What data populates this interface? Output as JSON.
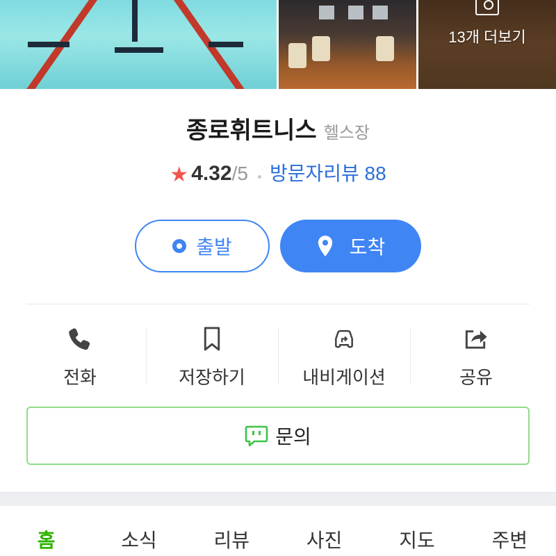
{
  "photos": {
    "more_label": "13개 더보기",
    "items": [
      "pool-photo",
      "lounge-photo",
      "gym-photo"
    ]
  },
  "place": {
    "name": "종로휘트니스",
    "category": "헬스장"
  },
  "rating": {
    "star": "★",
    "value": "4.32",
    "max": "/5",
    "review_link": "방문자리뷰 88"
  },
  "route": {
    "depart_label": "출발",
    "arrive_label": "도착"
  },
  "actions": [
    {
      "label": "전화",
      "icon": "phone-icon"
    },
    {
      "label": "저장하기",
      "icon": "bookmark-icon"
    },
    {
      "label": "내비게이션",
      "icon": "navigation-car-icon"
    },
    {
      "label": "공유",
      "icon": "share-icon"
    }
  ],
  "inquiry": {
    "label": "문의",
    "icon": "chat-icon"
  },
  "tabs": [
    {
      "label": "홈",
      "active": true
    },
    {
      "label": "소식"
    },
    {
      "label": "리뷰"
    },
    {
      "label": "사진"
    },
    {
      "label": "지도"
    },
    {
      "label": "주변"
    }
  ],
  "colors": {
    "accent_blue": "#3f85f4",
    "star_red": "#f05650",
    "tab_active_green": "#2db400",
    "inquiry_border": "#8fdc8a"
  }
}
